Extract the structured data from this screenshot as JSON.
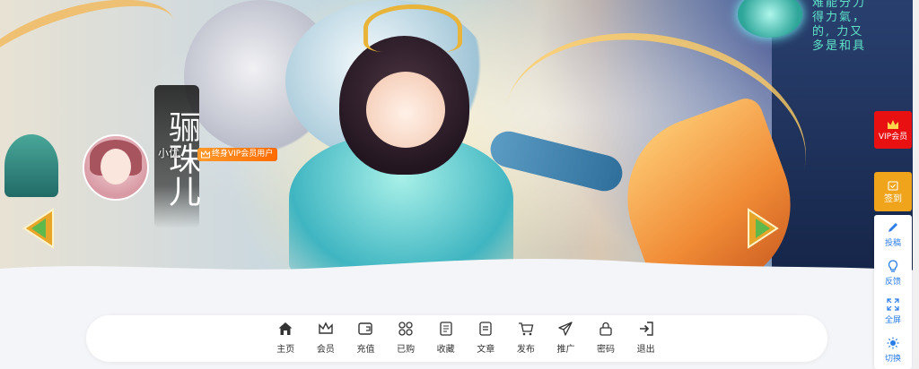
{
  "banner": {
    "side_text_lines": [
      "难能分力",
      "得力氣，",
      "的, 力又",
      "多是和具"
    ]
  },
  "profile": {
    "calligraphy_name": "骊珠儿",
    "username": "小优",
    "vip_badge": "终身VIP会员用户",
    "avatar_icon": "avatar-girl"
  },
  "nav": {
    "items": [
      {
        "label": "主页",
        "icon": "home-icon"
      },
      {
        "label": "会员",
        "icon": "crown-icon"
      },
      {
        "label": "充值",
        "icon": "wallet-icon"
      },
      {
        "label": "已购",
        "icon": "grid-icon"
      },
      {
        "label": "收藏",
        "icon": "bookmark-icon"
      },
      {
        "label": "文章",
        "icon": "document-icon"
      },
      {
        "label": "发布",
        "icon": "cart-icon"
      },
      {
        "label": "推广",
        "icon": "send-icon"
      },
      {
        "label": "密码",
        "icon": "lock-icon"
      },
      {
        "label": "退出",
        "icon": "logout-icon"
      }
    ]
  },
  "float_panel": {
    "vip_label": "VIP会员",
    "sign_label": "签到",
    "tools": [
      {
        "label": "投稿",
        "icon": "pencil-icon"
      },
      {
        "label": "反馈",
        "icon": "lightbulb-icon"
      },
      {
        "label": "全屏",
        "icon": "fullscreen-icon"
      },
      {
        "label": "切换",
        "icon": "sun-icon"
      }
    ]
  },
  "colors": {
    "accent_blue": "#2a7ce8",
    "vip_red": "#e81010",
    "sign_orange": "#f0a41c",
    "badge_orange": "#ff7a10"
  }
}
